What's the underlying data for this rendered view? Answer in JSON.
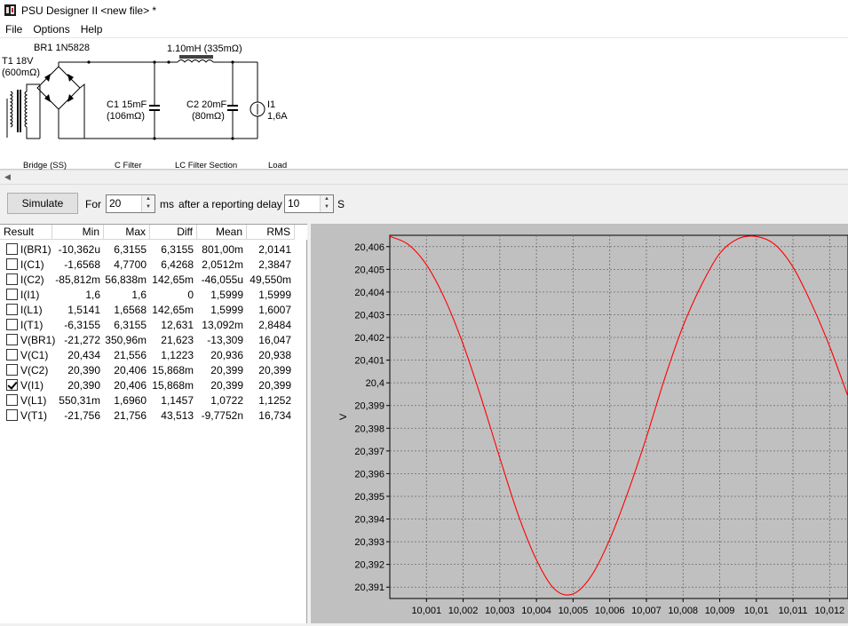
{
  "window": {
    "title": "PSU Designer II  <new file> *"
  },
  "menu": [
    "File",
    "Options",
    "Help"
  ],
  "schematic": {
    "rectifier_label": "BR1 1N5828",
    "transformer_label_1": "T1 18V",
    "transformer_label_2": "(600mΩ)",
    "inductor_label": "1.10mH (335mΩ)",
    "c1_label_1": "C1 15mF",
    "c1_label_2": "(106mΩ)",
    "c2_label_1": "C2 20mF",
    "c2_label_2": "(80mΩ)",
    "load_label_1": "I1",
    "load_label_2": "1,6A",
    "sections": [
      "Bridge (SS)",
      "C Filter",
      "LC Filter Section",
      "Load"
    ]
  },
  "controls": {
    "simulate_label": "Simulate",
    "for_label": "For",
    "duration_value": "20",
    "duration_unit": "ms",
    "delay_label": "after a reporting delay of",
    "delay_value": "10",
    "delay_unit": "S"
  },
  "results": {
    "columns": [
      "Result",
      "Min",
      "Max",
      "Diff",
      "Mean",
      "RMS"
    ],
    "rows": [
      {
        "name": "I(BR1)",
        "checked": false,
        "min": "-10,362u",
        "max": "6,3155",
        "diff": "6,3155",
        "mean": "801,00m",
        "rms": "2,0141"
      },
      {
        "name": "I(C1)",
        "checked": false,
        "min": "-1,6568",
        "max": "4,7700",
        "diff": "6,4268",
        "mean": "2,0512m",
        "rms": "2,3847"
      },
      {
        "name": "I(C2)",
        "checked": false,
        "min": "-85,812m",
        "max": "56,838m",
        "diff": "142,65m",
        "mean": "-46,055u",
        "rms": "49,550m"
      },
      {
        "name": "I(I1)",
        "checked": false,
        "min": "1,6",
        "max": "1,6",
        "diff": "0",
        "mean": "1,5999",
        "rms": "1,5999"
      },
      {
        "name": "I(L1)",
        "checked": false,
        "min": "1,5141",
        "max": "1,6568",
        "diff": "142,65m",
        "mean": "1,5999",
        "rms": "1,6007"
      },
      {
        "name": "I(T1)",
        "checked": false,
        "min": "-6,3155",
        "max": "6,3155",
        "diff": "12,631",
        "mean": "13,092m",
        "rms": "2,8484"
      },
      {
        "name": "V(BR1)",
        "checked": false,
        "min": "-21,272",
        "max": "350,96m",
        "diff": "21,623",
        "mean": "-13,309",
        "rms": "16,047"
      },
      {
        "name": "V(C1)",
        "checked": false,
        "min": "20,434",
        "max": "21,556",
        "diff": "1,1223",
        "mean": "20,936",
        "rms": "20,938"
      },
      {
        "name": "V(C2)",
        "checked": false,
        "min": "20,390",
        "max": "20,406",
        "diff": "15,868m",
        "mean": "20,399",
        "rms": "20,399"
      },
      {
        "name": "V(I1)",
        "checked": true,
        "min": "20,390",
        "max": "20,406",
        "diff": "15,868m",
        "mean": "20,399",
        "rms": "20,399"
      },
      {
        "name": "V(L1)",
        "checked": false,
        "min": "550,31m",
        "max": "1,6960",
        "diff": "1,1457",
        "mean": "1,0722",
        "rms": "1,1252"
      },
      {
        "name": "V(T1)",
        "checked": false,
        "min": "-21,756",
        "max": "21,756",
        "diff": "43,513",
        "mean": "-9,7752n",
        "rms": "16,734"
      }
    ]
  },
  "chart_data": {
    "type": "line",
    "ylabel": "V",
    "xlabel": "",
    "line_color": "#ff0000",
    "background": "#c0c0c0",
    "grid": true,
    "xlim": [
      10.0,
      10.0125
    ],
    "ylim": [
      20.3905,
      20.4065
    ],
    "x_ticks": [
      "10,001",
      "10,002",
      "10,003",
      "10,004",
      "10,005",
      "10,006",
      "10,007",
      "10,008",
      "10,009",
      "10,01",
      "10,011",
      "10,012"
    ],
    "y_ticks": [
      "20,406",
      "20,405",
      "20,404",
      "20,403",
      "20,402",
      "20,401",
      "20,4",
      "20,399",
      "20,398",
      "20,397",
      "20,396",
      "20,395",
      "20,394",
      "20,393",
      "20,392",
      "20,391"
    ],
    "series": [
      {
        "x": [
          10.0,
          10.0005,
          10.001,
          10.0015,
          10.002,
          10.0025,
          10.003,
          10.0035,
          10.004,
          10.0045,
          10.005,
          10.0055,
          10.006,
          10.0065,
          10.007,
          10.0075,
          10.008,
          10.0085,
          10.009,
          10.0095,
          10.01,
          10.0105,
          10.011,
          10.0115,
          10.012,
          10.0125
        ],
        "values": [
          20.40645,
          20.4061,
          20.4052,
          20.4037,
          20.4017,
          20.3993,
          20.3967,
          20.3942,
          20.3922,
          20.3909,
          20.3907,
          20.3915,
          20.3931,
          20.3952,
          20.3976,
          20.4002,
          20.4025,
          20.4043,
          20.4057,
          20.40635,
          20.40645,
          20.4061,
          20.4051,
          20.4035,
          20.4016,
          20.3994
        ]
      }
    ]
  }
}
